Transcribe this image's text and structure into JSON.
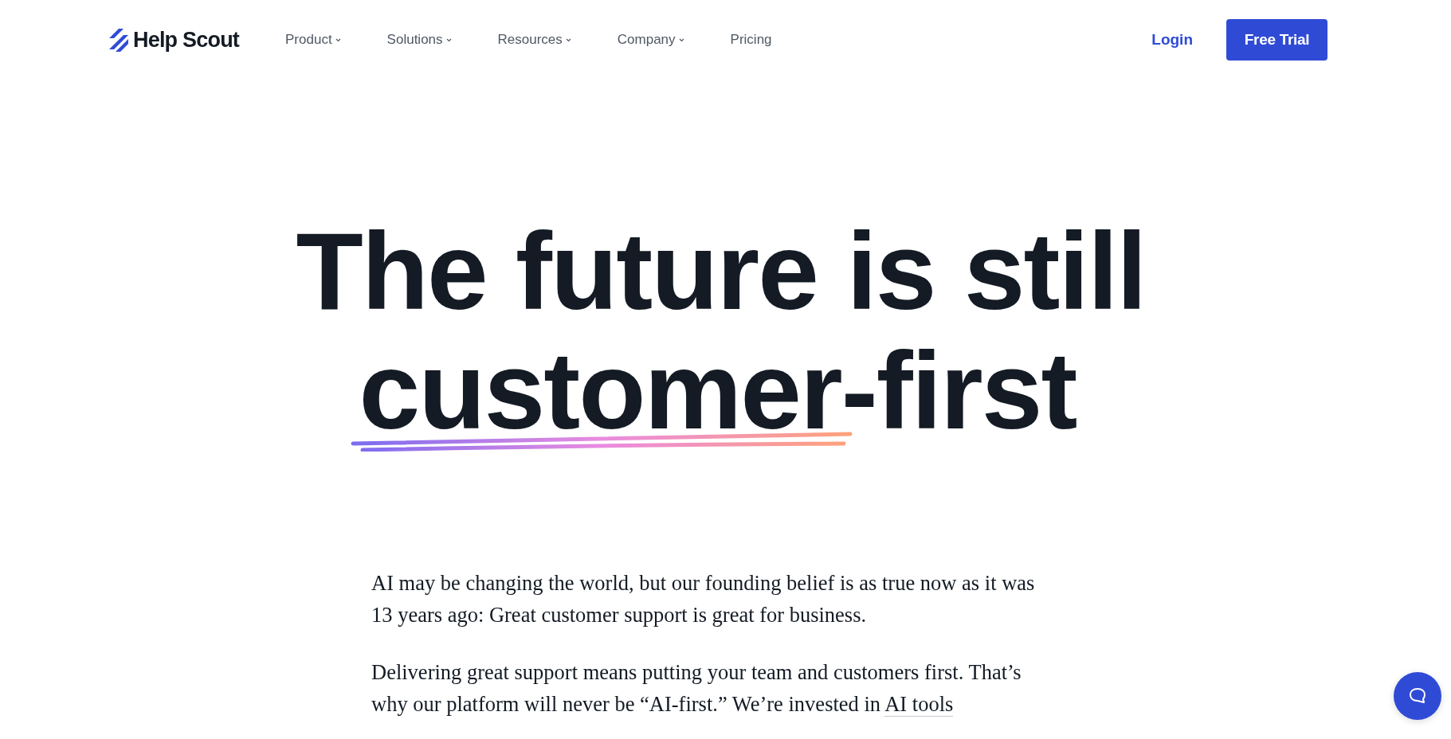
{
  "header": {
    "logo": "Help Scout",
    "nav": [
      {
        "label": "Product",
        "kind": "dropdown"
      },
      {
        "label": "Solutions",
        "kind": "dropdown"
      },
      {
        "label": "Resources",
        "kind": "dropdown"
      },
      {
        "label": "Company",
        "kind": "dropdown"
      },
      {
        "label": "Pricing",
        "kind": "link"
      }
    ],
    "login": "Login",
    "cta": "Free Trial"
  },
  "hero": {
    "line_1": "The future is still",
    "underlined": "customer",
    "rest": "-first"
  },
  "body": {
    "paragraphs": [
      {
        "text": "AI may be changing the world, but our founding belief is as true now as it was 13 years ago: Great customer support is great for business."
      },
      {
        "text": "Delivering great support means putting your team and customers first. That’s why our platform will never be “AI-first.” We’re invested in",
        "link": "AI tools"
      }
    ]
  }
}
